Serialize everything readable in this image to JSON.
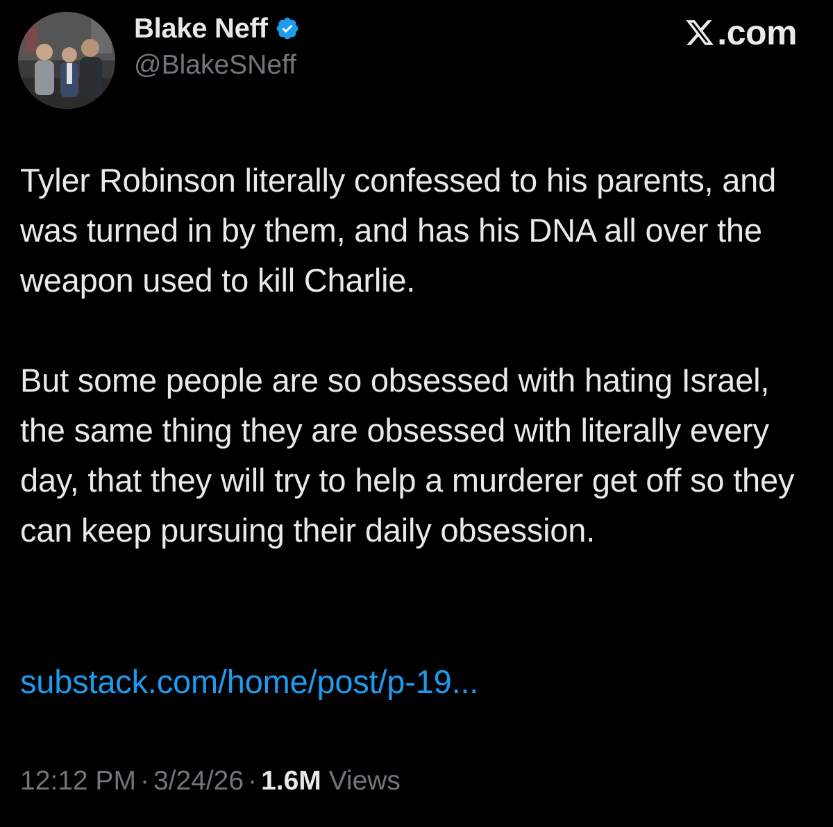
{
  "author": {
    "display_name": "Blake Neff",
    "handle": "@BlakeSNeff",
    "verified": true,
    "verified_color": "#1d9bf0",
    "avatar_icon": "profile-photo"
  },
  "site": {
    "logo_icon": "x-logo-icon",
    "suffix": ".com"
  },
  "tweet": {
    "paragraphs": [
      "Tyler Robinson literally confessed to his parents, and was turned in by them, and has his DNA all over the weapon used to kill Charlie.",
      "But some people are so obsessed with hating Israel, the same thing they are obsessed with literally every day, that they will try to help a murderer get off so they can keep pursuing their daily obsession."
    ],
    "link_text": "substack.com/home/post/p-19...",
    "link_color": "#1d9bf0"
  },
  "meta": {
    "time": "12:12 PM",
    "separator": "·",
    "date": "3/24/26",
    "views_count": "1.6M",
    "views_label": "Views"
  },
  "colors": {
    "background": "#000000",
    "text_primary": "#e7e9ea",
    "text_secondary": "#71767b"
  }
}
